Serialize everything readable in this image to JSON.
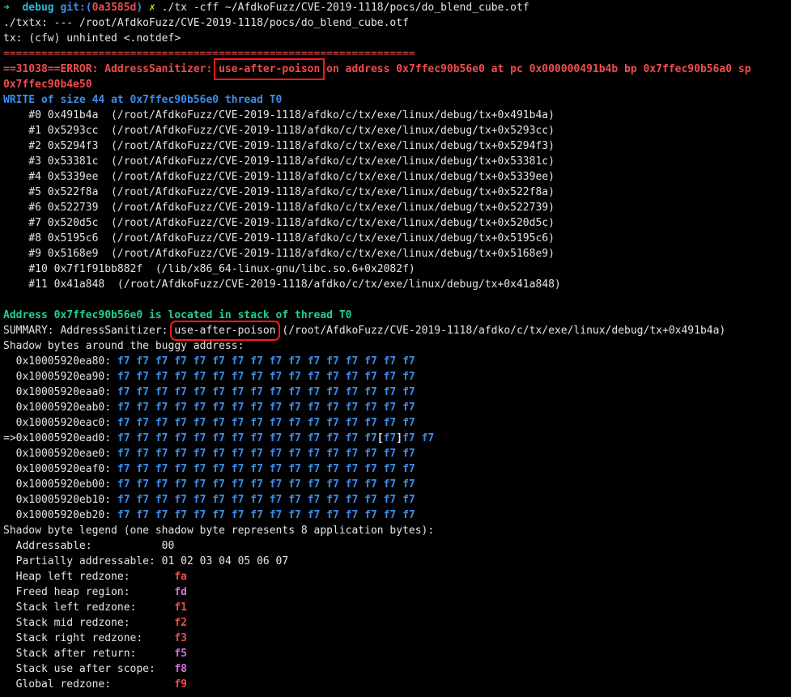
{
  "prompt": {
    "arrow": "➜",
    "dir": "debug",
    "git_label": "git:(",
    "git_hash": "0a3585d",
    "git_close": ")",
    "dirty": "✗",
    "command": "./tx -cff ~/AfdkoFuzz/CVE-2019-1118/pocs/do_blend_cube.otf"
  },
  "output_pre": [
    "./txtx: --- /root/AfdkoFuzz/CVE-2019-1118/pocs/do_blend_cube.otf",
    "tx: (cfw) unhinted <.notdef>"
  ],
  "separator": "=================================================================",
  "error": {
    "prefix": "==31038==ERROR: AddressSanitizer: ",
    "type": "use-after-poison",
    "suffix": " on address 0x7ffec90b56e0 at pc 0x000000491b4b bp 0x7ffec90b56a0 sp 0x7ffec90b4e50"
  },
  "write_line": "WRITE of size 44 at 0x7ffec90b56e0 thread T0",
  "stack": [
    "    #0 0x491b4a  (/root/AfdkoFuzz/CVE-2019-1118/afdko/c/tx/exe/linux/debug/tx+0x491b4a)",
    "    #1 0x5293cc  (/root/AfdkoFuzz/CVE-2019-1118/afdko/c/tx/exe/linux/debug/tx+0x5293cc)",
    "    #2 0x5294f3  (/root/AfdkoFuzz/CVE-2019-1118/afdko/c/tx/exe/linux/debug/tx+0x5294f3)",
    "    #3 0x53381c  (/root/AfdkoFuzz/CVE-2019-1118/afdko/c/tx/exe/linux/debug/tx+0x53381c)",
    "    #4 0x5339ee  (/root/AfdkoFuzz/CVE-2019-1118/afdko/c/tx/exe/linux/debug/tx+0x5339ee)",
    "    #5 0x522f8a  (/root/AfdkoFuzz/CVE-2019-1118/afdko/c/tx/exe/linux/debug/tx+0x522f8a)",
    "    #6 0x522739  (/root/AfdkoFuzz/CVE-2019-1118/afdko/c/tx/exe/linux/debug/tx+0x522739)",
    "    #7 0x520d5c  (/root/AfdkoFuzz/CVE-2019-1118/afdko/c/tx/exe/linux/debug/tx+0x520d5c)",
    "    #8 0x5195c6  (/root/AfdkoFuzz/CVE-2019-1118/afdko/c/tx/exe/linux/debug/tx+0x5195c6)",
    "    #9 0x5168e9  (/root/AfdkoFuzz/CVE-2019-1118/afdko/c/tx/exe/linux/debug/tx+0x5168e9)",
    "    #10 0x7f1f91bb882f  (/lib/x86_64-linux-gnu/libc.so.6+0x2082f)",
    "    #11 0x41a848  (/root/AfdkoFuzz/CVE-2019-1118/afdko/c/tx/exe/linux/debug/tx+0x41a848)"
  ],
  "located": "Address 0x7ffec90b56e0 is located in stack of thread T0",
  "summary": {
    "prefix": "SUMMARY: AddressSanitizer: ",
    "type": "use-after-poison",
    "suffix": " (/root/AfdkoFuzz/CVE-2019-1118/afdko/c/tx/exe/linux/debug/tx+0x491b4a)"
  },
  "shadow_header": "Shadow bytes around the buggy address:",
  "shadow_rows": [
    {
      "addr": "  0x10005920ea80: ",
      "bytes": "f7 f7 f7 f7 f7 f7 f7 f7 f7 f7 f7 f7 f7 f7 f7 f7"
    },
    {
      "addr": "  0x10005920ea90: ",
      "bytes": "f7 f7 f7 f7 f7 f7 f7 f7 f7 f7 f7 f7 f7 f7 f7 f7"
    },
    {
      "addr": "  0x10005920eaa0: ",
      "bytes": "f7 f7 f7 f7 f7 f7 f7 f7 f7 f7 f7 f7 f7 f7 f7 f7"
    },
    {
      "addr": "  0x10005920eab0: ",
      "bytes": "f7 f7 f7 f7 f7 f7 f7 f7 f7 f7 f7 f7 f7 f7 f7 f7"
    },
    {
      "addr": "  0x10005920eac0: ",
      "bytes": "f7 f7 f7 f7 f7 f7 f7 f7 f7 f7 f7 f7 f7 f7 f7 f7"
    }
  ],
  "shadow_buggy": {
    "addr": "=>0x10005920ead0: ",
    "before": "f7 f7 f7 f7 f7 f7 f7 f7 f7 f7 f7 f7 f7",
    "open": "[",
    "value": "f7",
    "close": "]",
    "after": "f7 f7"
  },
  "shadow_rows_after": [
    {
      "addr": "  0x10005920eae0: ",
      "bytes": "f7 f7 f7 f7 f7 f7 f7 f7 f7 f7 f7 f7 f7 f7 f7 f7"
    },
    {
      "addr": "  0x10005920eaf0: ",
      "bytes": "f7 f7 f7 f7 f7 f7 f7 f7 f7 f7 f7 f7 f7 f7 f7 f7"
    },
    {
      "addr": "  0x10005920eb00: ",
      "bytes": "f7 f7 f7 f7 f7 f7 f7 f7 f7 f7 f7 f7 f7 f7 f7 f7"
    },
    {
      "addr": "  0x10005920eb10: ",
      "bytes": "f7 f7 f7 f7 f7 f7 f7 f7 f7 f7 f7 f7 f7 f7 f7 f7"
    },
    {
      "addr": "  0x10005920eb20: ",
      "bytes": "f7 f7 f7 f7 f7 f7 f7 f7 f7 f7 f7 f7 f7 f7 f7 f7"
    }
  ],
  "legend_header": "Shadow byte legend (one shadow byte represents 8 application bytes):",
  "legend": [
    {
      "label": "  Addressable:           ",
      "value": "00",
      "color": "plain"
    },
    {
      "label": "  Partially addressable: ",
      "value": "01 02 03 04 05 06 07",
      "color": "plain"
    },
    {
      "label": "  Heap left redzone:       ",
      "value": "fa",
      "color": "red"
    },
    {
      "label": "  Freed heap region:       ",
      "value": "fd",
      "color": "magenta"
    },
    {
      "label": "  Stack left redzone:      ",
      "value": "f1",
      "color": "red"
    },
    {
      "label": "  Stack mid redzone:       ",
      "value": "f2",
      "color": "red"
    },
    {
      "label": "  Stack right redzone:     ",
      "value": "f3",
      "color": "red"
    },
    {
      "label": "  Stack after return:      ",
      "value": "f5",
      "color": "magenta"
    },
    {
      "label": "  Stack use after scope:   ",
      "value": "f8",
      "color": "magenta"
    },
    {
      "label": "  Global redzone:          ",
      "value": "f9",
      "color": "red"
    }
  ],
  "colors": {
    "background": "#000000",
    "text": "#e5e5e5",
    "error_red": "#f14c4c",
    "info_blue": "#3b8eea",
    "success_green": "#23d18b",
    "highlight_box": "#ff1a1a"
  }
}
